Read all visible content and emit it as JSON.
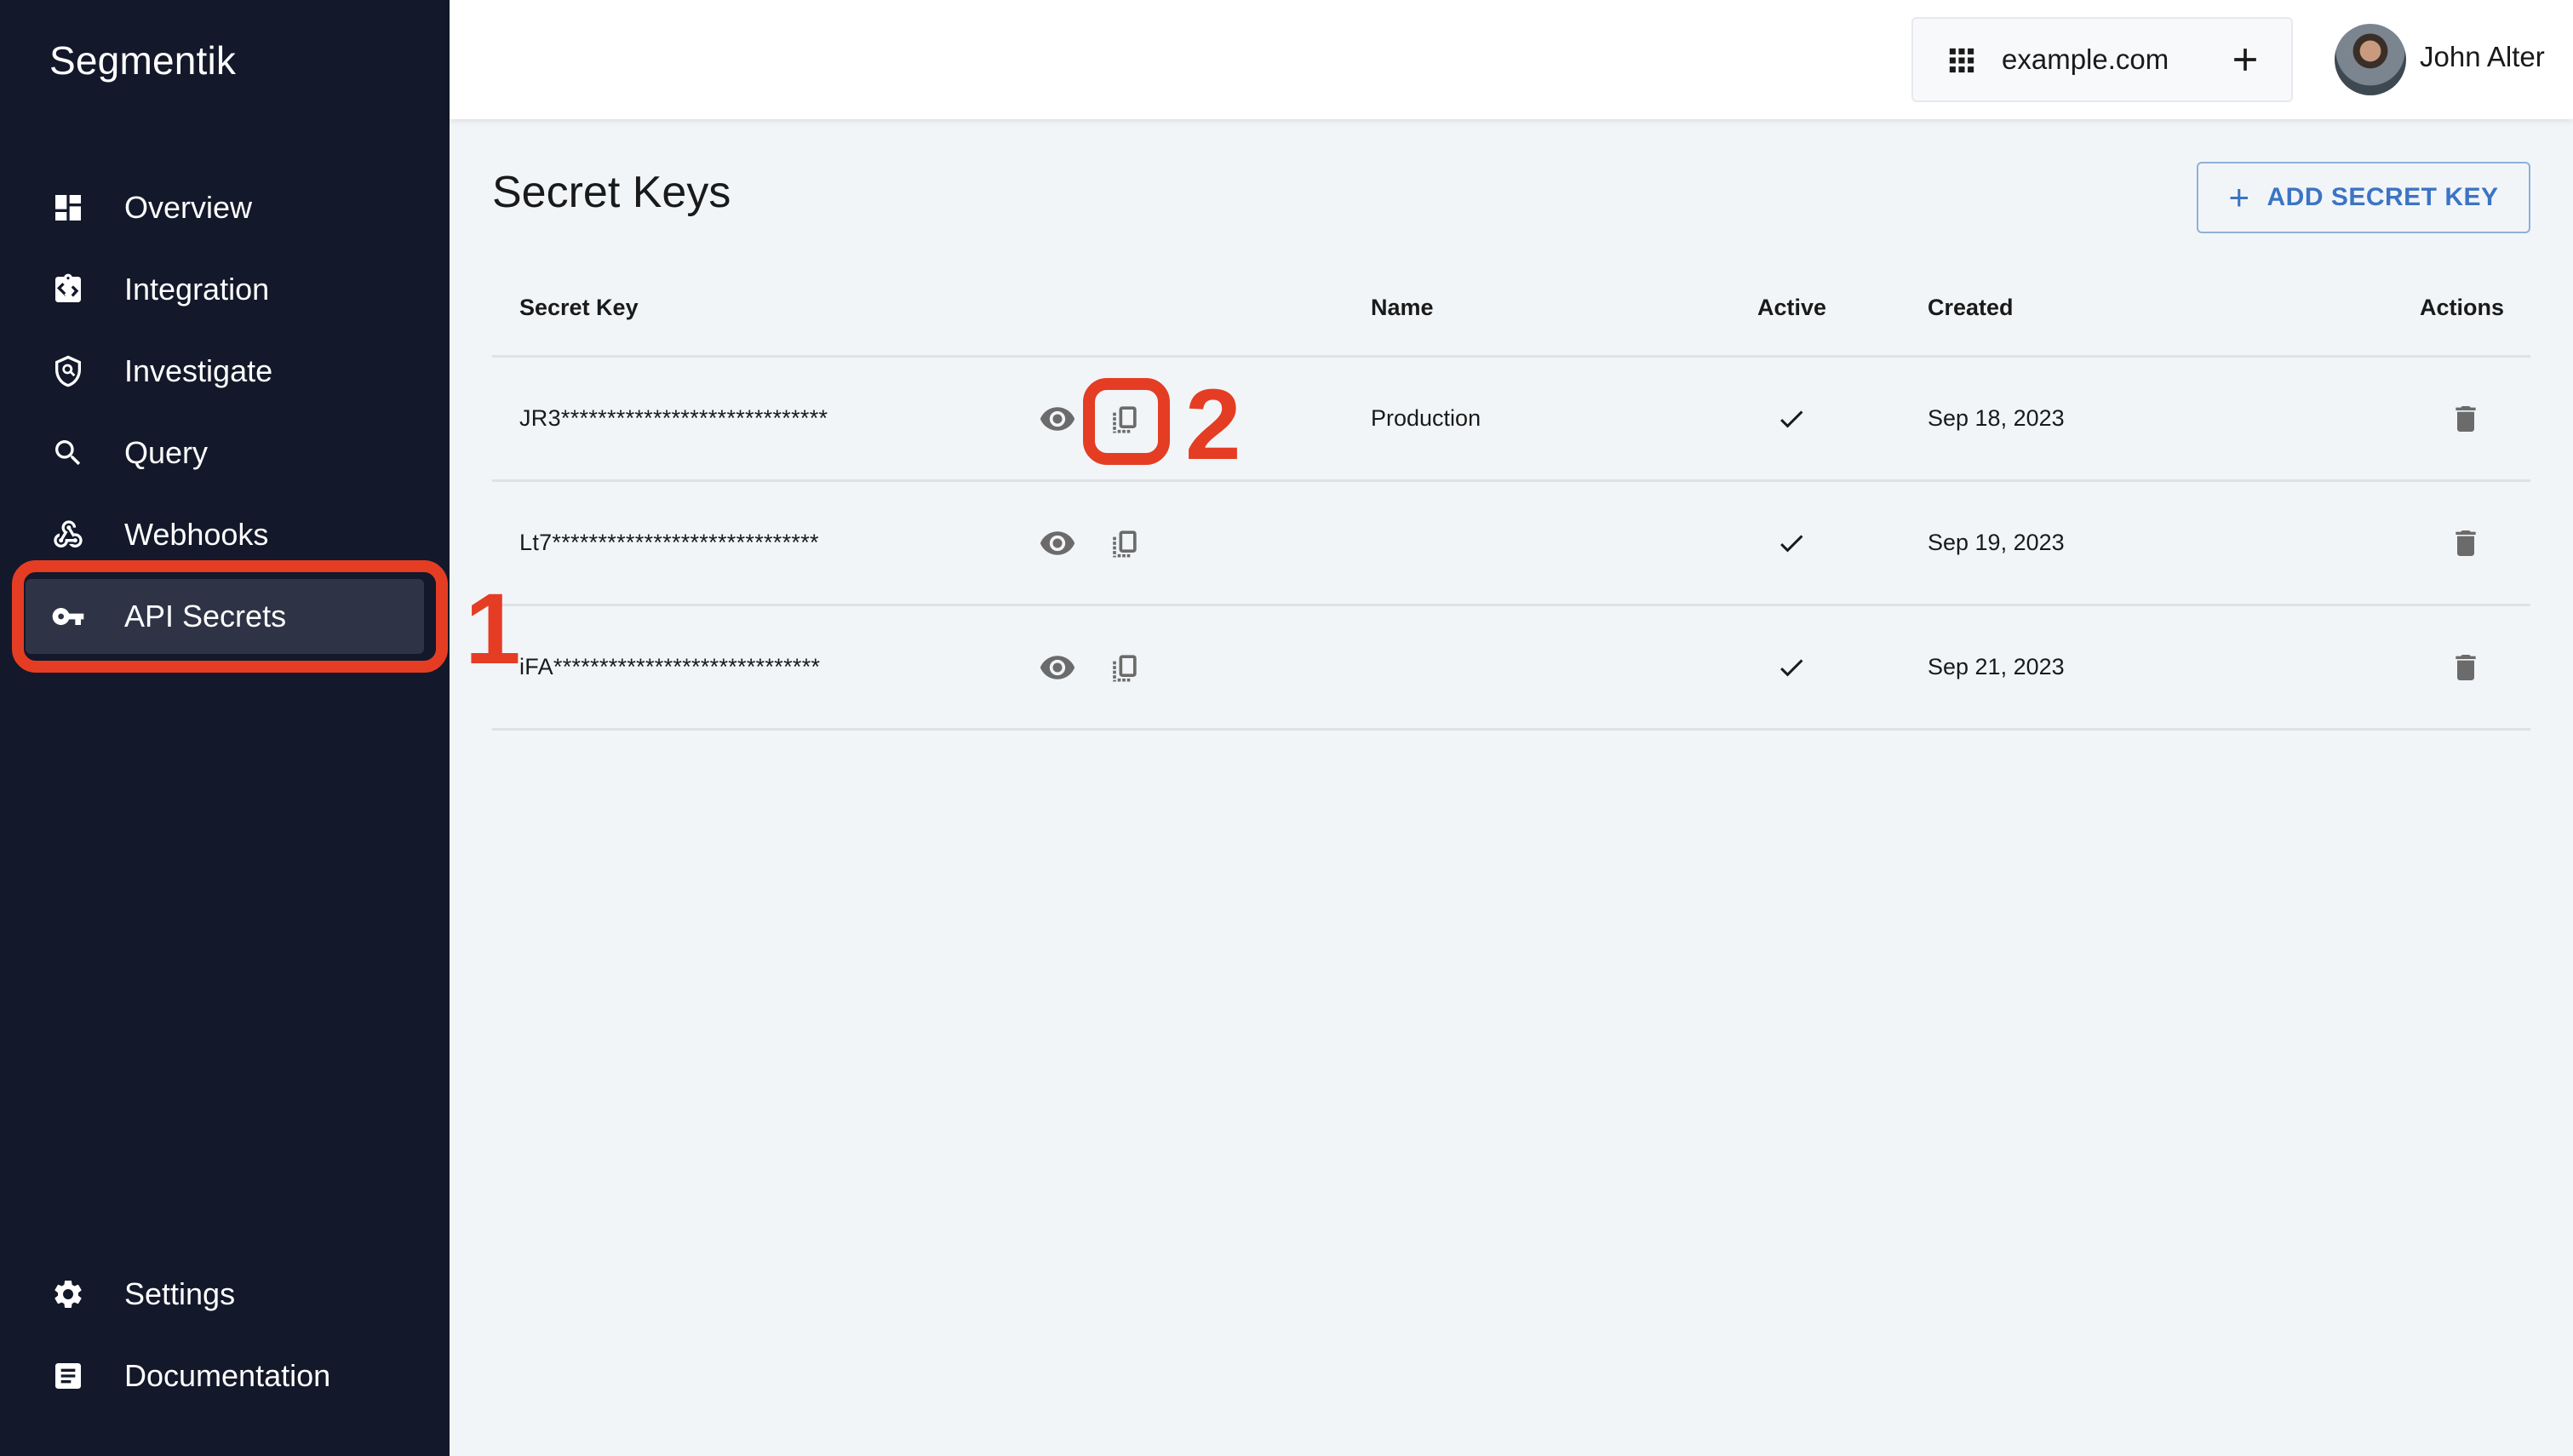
{
  "app": {
    "brand": "Segmentik"
  },
  "sidebar": {
    "items": [
      {
        "label": "Overview",
        "icon": "dashboard-icon"
      },
      {
        "label": "Integration",
        "icon": "integration-icon"
      },
      {
        "label": "Investigate",
        "icon": "investigate-icon"
      },
      {
        "label": "Query",
        "icon": "search-icon"
      },
      {
        "label": "Webhooks",
        "icon": "webhook-icon"
      },
      {
        "label": "API Secrets",
        "icon": "key-icon",
        "active": true
      }
    ],
    "bottom_items": [
      {
        "label": "Settings",
        "icon": "gear-icon"
      },
      {
        "label": "Documentation",
        "icon": "document-icon"
      }
    ]
  },
  "header": {
    "site": "example.com",
    "user_name": "John Alter"
  },
  "main": {
    "title": "Secret Keys",
    "add_button_label": "ADD SECRET KEY",
    "table": {
      "columns": [
        "Secret Key",
        "Name",
        "Active",
        "Created",
        "Actions"
      ],
      "rows": [
        {
          "key": "JR3*****************************",
          "name": "Production",
          "active": true,
          "created": "Sep 18, 2023"
        },
        {
          "key": "Lt7*****************************",
          "name": "",
          "active": true,
          "created": "Sep 19, 2023"
        },
        {
          "key": "iFA*****************************",
          "name": "",
          "active": true,
          "created": "Sep 21, 2023"
        }
      ]
    }
  },
  "annotations": {
    "step1": "1",
    "step2": "2",
    "color": "#e43d24"
  },
  "colors": {
    "sidebar_bg": "#13182a",
    "sidebar_active": "#2e3345",
    "content_bg": "#f2f5f8",
    "accent": "#3b74c4",
    "icon_gray": "#6b6b6b"
  }
}
